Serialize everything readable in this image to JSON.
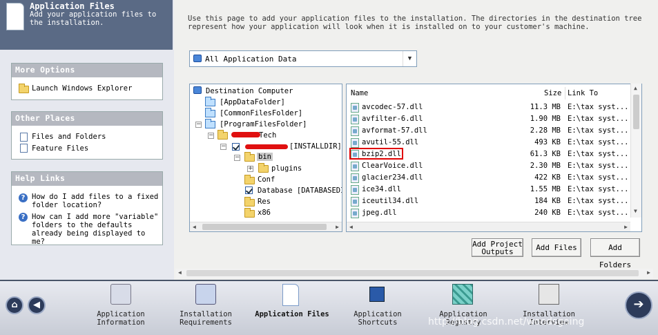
{
  "header": {
    "title": "Application Files",
    "subtitle": "Add your application files to the installation."
  },
  "more_options": {
    "title": "More Options",
    "items": [
      "Launch Windows Explorer"
    ]
  },
  "other_places": {
    "title": "Other Places",
    "items": [
      "Files and Folders",
      "Feature Files"
    ]
  },
  "help_links": {
    "title": "Help Links",
    "items": [
      "How do I add files to a fixed folder location?",
      "How can I add more \"variable\" folders to the defaults already being displayed to me?"
    ]
  },
  "description": "Use this page to add your application files to the installation. The directories in the destination tree represent how your application will look when it is installed on to your customer's machine.",
  "feature_select": {
    "value": "All Application Data"
  },
  "tree": {
    "root": "Destination Computer",
    "nodes": [
      "[AppDataFolder]",
      "[CommonFilesFolder]",
      "[ProgramFilesFolder]",
      "Tech",
      "[INSTALLDIR]",
      "bin",
      "plugins",
      "Conf",
      "Database [DATABASEDI",
      "Res",
      "x86"
    ]
  },
  "list": {
    "columns": [
      "Name",
      "Size",
      "Link To"
    ],
    "rows": [
      {
        "name": "avcodec-57.dll",
        "size": "11.3 MB",
        "link": "E:\\tax syst..."
      },
      {
        "name": "avfilter-6.dll",
        "size": "1.90 MB",
        "link": "E:\\tax syst..."
      },
      {
        "name": "avformat-57.dll",
        "size": "2.28 MB",
        "link": "E:\\tax syst..."
      },
      {
        "name": "avutil-55.dll",
        "size": "493 KB",
        "link": "E:\\tax syst..."
      },
      {
        "name": "bzip2.dll",
        "size": "61.3 KB",
        "link": "E:\\tax syst..."
      },
      {
        "name": "ClearVoice.dll",
        "size": "2.30 MB",
        "link": "E:\\tax syst..."
      },
      {
        "name": "glacier234.dll",
        "size": "422 KB",
        "link": "E:\\tax syst..."
      },
      {
        "name": "ice34.dll",
        "size": "1.55 MB",
        "link": "E:\\tax syst..."
      },
      {
        "name": "iceutil34.dll",
        "size": "184 KB",
        "link": "E:\\tax syst..."
      },
      {
        "name": "jpeg.dll",
        "size": "240 KB",
        "link": "E:\\tax syst..."
      }
    ],
    "highlighted_row": "bzip2.dll"
  },
  "buttons": {
    "add_project_outputs": "Add Project Outputs",
    "add_files": "Add Files",
    "add_folders": "Add Folders"
  },
  "bottom_nav": [
    {
      "label": "Application Information",
      "icon": "app-info-icon"
    },
    {
      "label": "Installation Requirements",
      "icon": "requirements-icon"
    },
    {
      "label": "Application Files",
      "icon": "app-files-icon",
      "active": true
    },
    {
      "label": "Application Shortcuts",
      "icon": "shortcuts-icon"
    },
    {
      "label": "Application Registry",
      "icon": "registry-icon"
    },
    {
      "label": "Installation Interview",
      "icon": "interview-icon"
    }
  ],
  "watermark": "http://blog.csdn.net/woodsgoing",
  "colors": {
    "header_bg": "#5a6a85",
    "panel_header_bg": "#b5b8c0",
    "highlight_border": "#e00000",
    "redaction": "#e01010"
  }
}
